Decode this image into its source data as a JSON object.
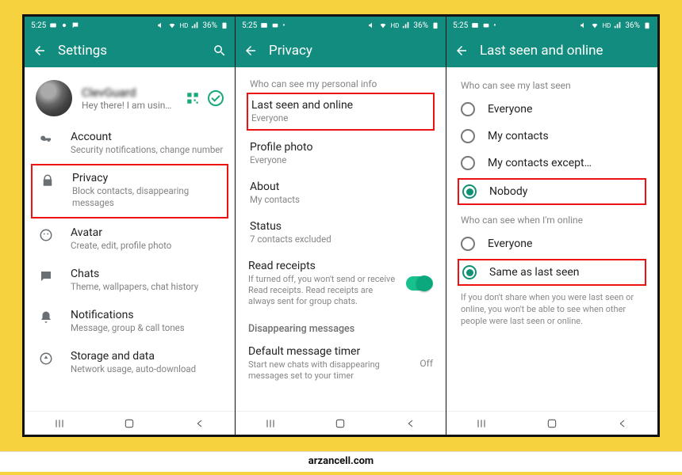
{
  "status": {
    "time": "5:25",
    "battery": "36%",
    "net": "HD"
  },
  "brand": "arzancell.com",
  "screen1": {
    "title": "Settings",
    "profile_name": "ClevGuard",
    "profile_sub": "Hey there! I am usin…",
    "items": [
      {
        "label": "Account",
        "sub": "Security notifications, change number"
      },
      {
        "label": "Privacy",
        "sub": "Block contacts, disappearing messages"
      },
      {
        "label": "Avatar",
        "sub": "Create, edit, profile photo"
      },
      {
        "label": "Chats",
        "sub": "Theme, wallpapers, chat history"
      },
      {
        "label": "Notifications",
        "sub": "Message, group & call tones"
      },
      {
        "label": "Storage and data",
        "sub": "Network usage, auto-download"
      }
    ]
  },
  "screen2": {
    "title": "Privacy",
    "head": "Who can see my personal info",
    "items": [
      {
        "label": "Last seen and online",
        "sub": "Everyone"
      },
      {
        "label": "Profile photo",
        "sub": "Everyone"
      },
      {
        "label": "About",
        "sub": "My contacts"
      },
      {
        "label": "Status",
        "sub": "7 contacts excluded"
      }
    ],
    "read_receipts": {
      "label": "Read receipts",
      "sub": "If turned off, you won't send or receive Read receipts. Read receipts are always sent for group chats."
    },
    "section2": "Disappearing messages",
    "timer": {
      "label": "Default message timer",
      "sub": "Start new chats with disappearing messages set to your timer",
      "value": "Off"
    }
  },
  "screen3": {
    "title": "Last seen and online",
    "head1": "Who can see my last seen",
    "opts1": [
      "Everyone",
      "My contacts",
      "My contacts except…",
      "Nobody"
    ],
    "sel1": 3,
    "head2": "Who can see when I'm online",
    "opts2": [
      "Everyone",
      "Same as last seen"
    ],
    "sel2": 1,
    "note": "If you don't share when you were last seen or online, you won't be able to see when other people were last seen or online."
  }
}
